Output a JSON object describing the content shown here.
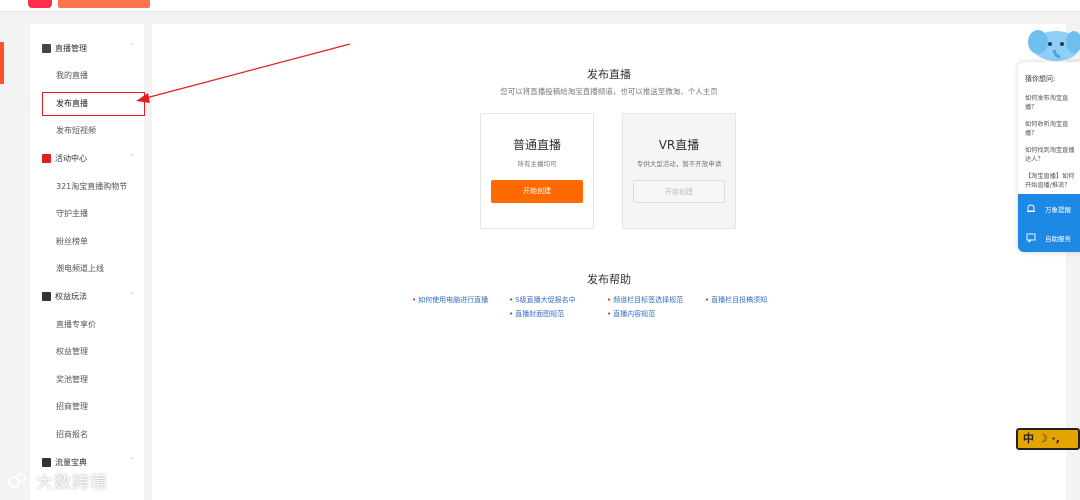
{
  "colors": {
    "accent": "#ff6a00",
    "brand": "#ff2e4d",
    "highlight_box": "#e02020",
    "link": "#2f6ebf",
    "assistant_blue": "#1e88e5"
  },
  "sidebar": {
    "groups": [
      {
        "label": "直播管理",
        "icon": "tv-icon",
        "color": "#444444",
        "items": [
          "我的直播",
          "发布直播",
          "发布短视频"
        ]
      },
      {
        "label": "活动中心",
        "icon": "flag-icon",
        "color": "#e02020",
        "items": [
          "321淘宝直播购物节",
          "守护主播",
          "粉丝榜单",
          "潮电频道上线"
        ]
      },
      {
        "label": "权益玩法",
        "icon": "gift-icon",
        "color": "#333333",
        "items": [
          "直播专享价",
          "权益管理",
          "奖池管理",
          "招商管理",
          "招商报名"
        ]
      },
      {
        "label": "流量宝典",
        "icon": "chart-icon",
        "color": "#333333",
        "items": []
      }
    ],
    "active_item": "发布直播"
  },
  "main": {
    "title": "发布直播",
    "subtitle": "您可以将直播投稿给淘宝直播频道，也可以推送至微淘、个人主页",
    "cards": [
      {
        "title": "普通直播",
        "desc": "所有主播均可",
        "button": "开始创建"
      },
      {
        "title": "VR直播",
        "desc": "专供大型活动，暂不开放申请",
        "button": "开始创建"
      }
    ],
    "help": {
      "title": "发布帮助",
      "links": [
        "如何使用电脑进行直播",
        "S级直播大促报名中",
        "频道栏目标签选择规范",
        "直播栏目投稿须知",
        "直播封面图规范",
        "直播内容规范"
      ]
    }
  },
  "assistant": {
    "ask": "猜你想问:",
    "questions": [
      "如何发布淘宝直播？",
      "如何收听淘宝直播？",
      "如何找到淘宝直播达人？",
      "【淘宝直播】如何开始直播/推流？"
    ],
    "actions": [
      "万象提醒",
      "自助服务"
    ]
  },
  "badge": {
    "text": "中 ☽ ·,"
  },
  "watermark": {
    "text": "大数跨境"
  }
}
